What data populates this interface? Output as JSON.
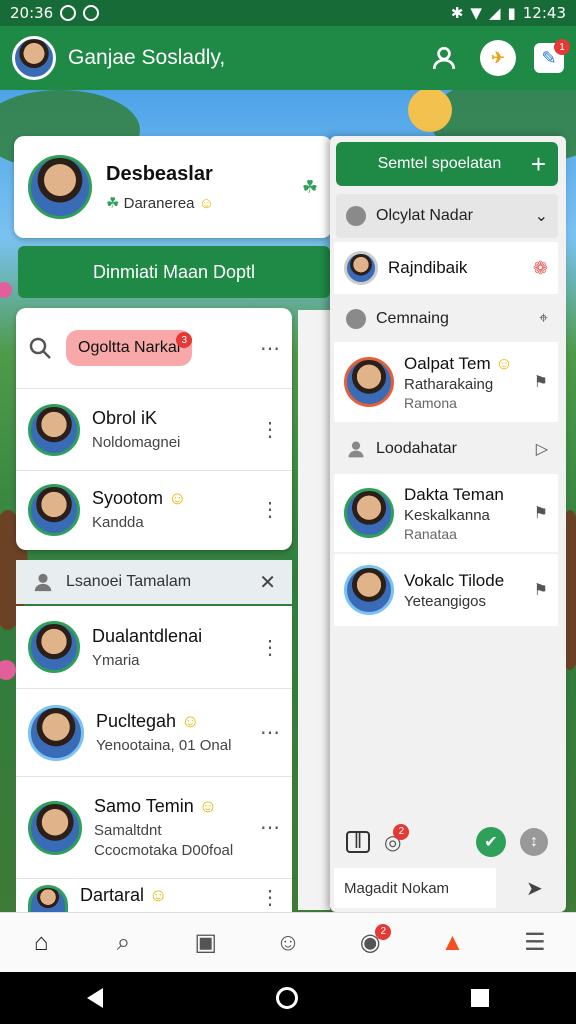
{
  "status": {
    "time": "20:36",
    "clock_right": "12:43"
  },
  "appbar": {
    "title": "Ganjae Sosladly,",
    "badge": "1"
  },
  "profile": {
    "name": "Desbeaslar",
    "subtitle": "Daranerea"
  },
  "main_button": {
    "label": "Dinmiati Maan Doptl"
  },
  "search": {
    "pill": "Ogoltta Narkal",
    "pill_badge": "3"
  },
  "chats_top": [
    {
      "name": "Obrol iK",
      "preview": "Noldomagnei"
    },
    {
      "name": "Syootom",
      "preview": "Kandda"
    }
  ],
  "section": {
    "label": "Lsanoei Tamalam"
  },
  "chats_bottom": [
    {
      "name": "Dualantdlenai",
      "preview": "Ymaria"
    },
    {
      "name": "Pucltegah",
      "preview": "Yenootaina, 01 Onal"
    },
    {
      "name": "Samo Temin",
      "preview": "Samaltdnt",
      "preview2": "Ccocmotaka D00foal"
    },
    {
      "name": "Dartaral",
      "preview": ""
    }
  ],
  "panel": {
    "new_button": "Semtel spoelatan",
    "dropdown": "Olcylat Nadar",
    "user_row": "Rajndibaik",
    "row_a": "Cemnaing",
    "contact1": {
      "name": "Oalpat Tem",
      "line2": "Ratharakaing",
      "line3": "Ramona"
    },
    "row_b": "Loodahatar",
    "contact2": {
      "name": "Dakta Teman",
      "line2": "Keskalkanna",
      "line3": "Ranataa"
    },
    "contact3": {
      "name": "Vokalc Tilode",
      "line2": "Yeteangigos"
    },
    "compose_placeholder": "Magadit Nokam",
    "badge": "2"
  },
  "bottom_nav": {
    "badge": "2"
  },
  "colors": {
    "primary": "#1f8a46",
    "pill": "#f8a8a8",
    "badge": "#e53935"
  }
}
